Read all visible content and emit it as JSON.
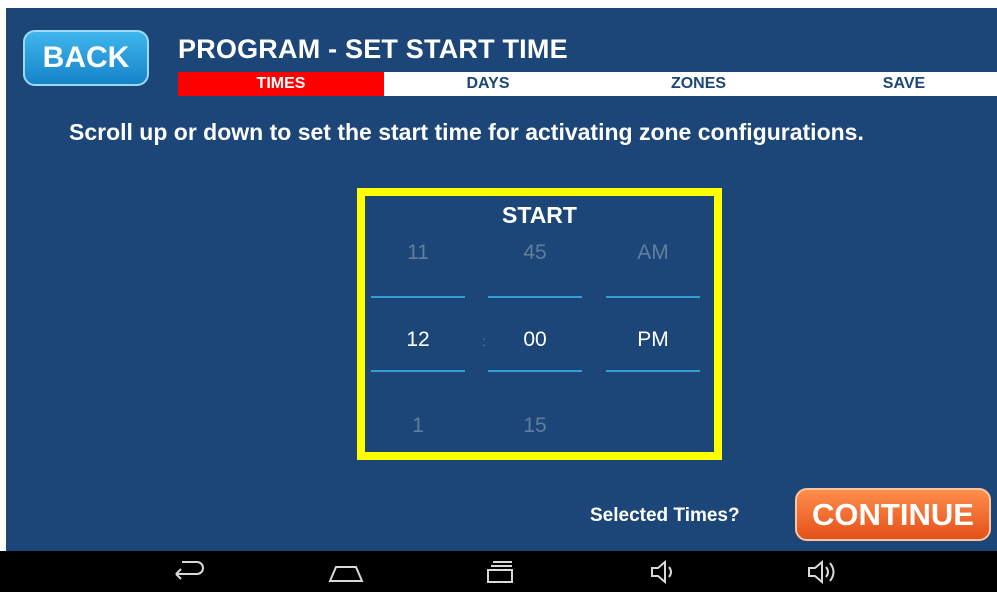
{
  "header": {
    "back_label": "BACK",
    "title": "PROGRAM - SET START TIME",
    "steps": [
      {
        "label": "TIMES",
        "active": true
      },
      {
        "label": "DAYS",
        "active": false
      },
      {
        "label": "ZONES",
        "active": false
      },
      {
        "label": "SAVE",
        "active": false
      }
    ]
  },
  "instructions": "Scroll up or down to set the start time for activating zone configurations.",
  "picker": {
    "title": "START",
    "hour": {
      "prev": "11",
      "selected": "12",
      "next": "1"
    },
    "separator": ":",
    "minute": {
      "prev": "45",
      "selected": "00",
      "next": "15"
    },
    "ampm": {
      "prev": "AM",
      "selected": "PM",
      "next": ""
    }
  },
  "footer": {
    "selected_label": "Selected Times?",
    "continue_label": "CONTINUE"
  },
  "navbar": {
    "icons": [
      "back-icon",
      "home-icon",
      "recent-apps-icon",
      "volume-down-icon",
      "volume-up-icon"
    ]
  },
  "colors": {
    "background": "#1b4677",
    "active_step": "#ff0000",
    "picker_border": "#ffff00",
    "back_button": "#1f95d8",
    "continue_button": "#f06a2e"
  }
}
